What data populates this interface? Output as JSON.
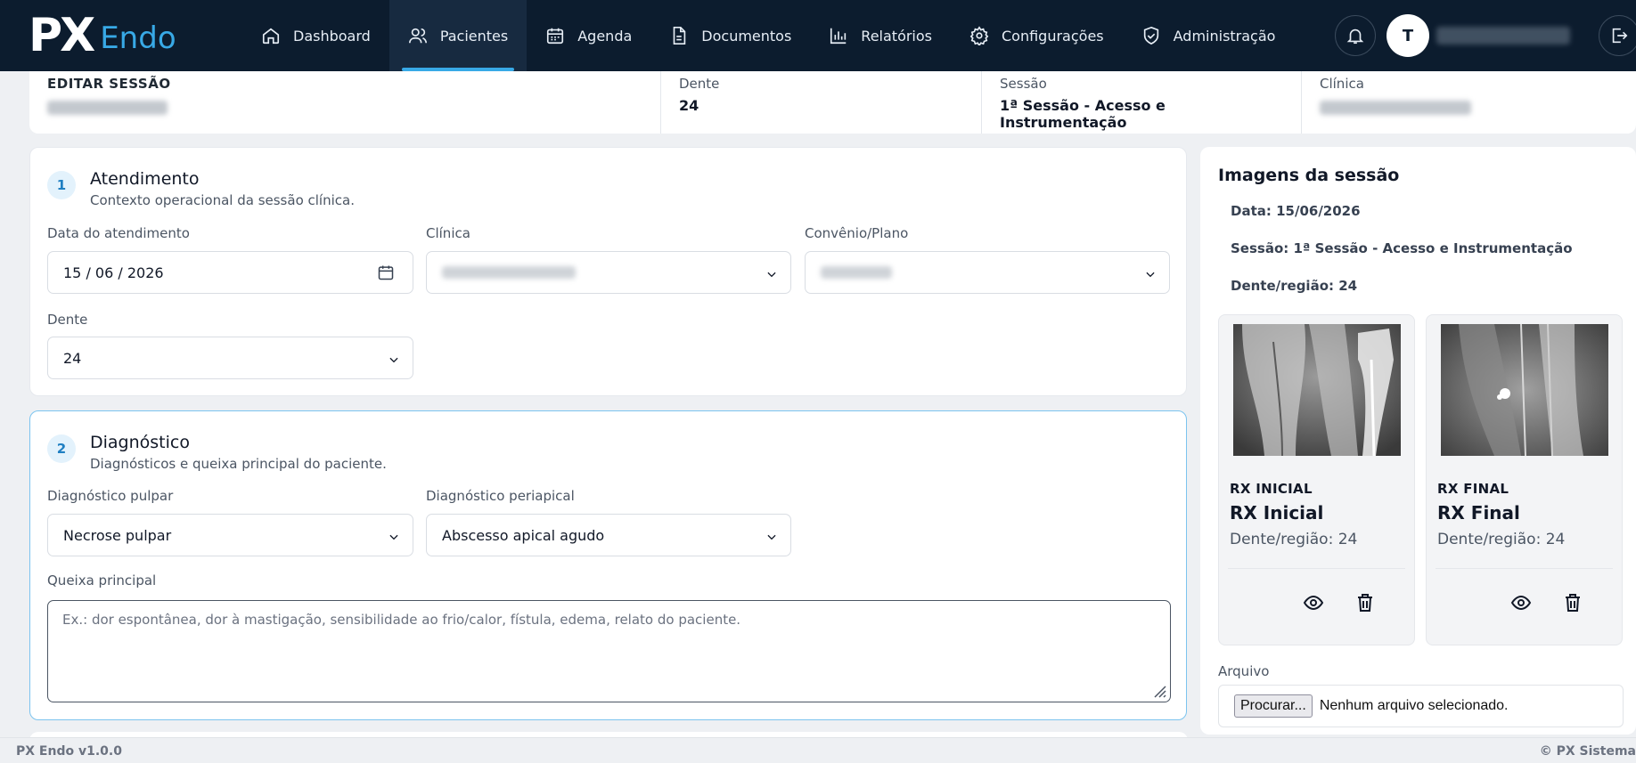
{
  "app": {
    "logo_px": "PX",
    "logo_endo": "Endo"
  },
  "nav": {
    "items": [
      {
        "label": "Dashboard",
        "icon": "home-icon"
      },
      {
        "label": "Pacientes",
        "icon": "users-icon",
        "active": true
      },
      {
        "label": "Agenda",
        "icon": "calendar-icon"
      },
      {
        "label": "Documentos",
        "icon": "document-icon"
      },
      {
        "label": "Relatórios",
        "icon": "bar-chart-icon"
      },
      {
        "label": "Configurações",
        "icon": "gear-icon"
      },
      {
        "label": "Administração",
        "icon": "shield-icon"
      }
    ],
    "avatar_initial": "T"
  },
  "summary": {
    "title": "EDITAR SESSÃO",
    "dente_label": "Dente",
    "dente_value": "24",
    "sessao_label": "Sessão",
    "sessao_value": "1ª Sessão - Acesso e Instrumentação",
    "clinica_label": "Clínica"
  },
  "atendimento": {
    "step": "1",
    "title": "Atendimento",
    "subtitle": "Contexto operacional da sessão clínica.",
    "date_label": "Data do atendimento",
    "date_value": "15 / 06 / 2026",
    "clinica_label": "Clínica",
    "convenio_label": "Convênio/Plano",
    "dente_label": "Dente",
    "dente_value": "24"
  },
  "diagnostico": {
    "step": "2",
    "title": "Diagnóstico",
    "subtitle": "Diagnósticos e queixa principal do paciente.",
    "pulpar_label": "Diagnóstico pulpar",
    "pulpar_value": "Necrose pulpar",
    "periapical_label": "Diagnóstico periapical",
    "periapical_value": "Abscesso apical agudo",
    "queixa_label": "Queixa principal",
    "queixa_placeholder": "Ex.: dor espontânea, dor à mastigação, sensibilidade ao frio/calor, fístula, edema, relato do paciente."
  },
  "images": {
    "title": "Imagens da sessão",
    "data_line": "Data: 15/06/2026",
    "sessao_line": "Sessão: 1ª Sessão - Acesso e Instrumentação",
    "dente_line": "Dente/região: 24",
    "items": [
      {
        "kicker": "RX INICIAL",
        "title": "RX Inicial",
        "sub": "Dente/região: 24"
      },
      {
        "kicker": "RX FINAL",
        "title": "RX Final",
        "sub": "Dente/região: 24"
      }
    ],
    "file_label": "Arquivo",
    "file_button": "Procurar...",
    "file_status": "Nenhum arquivo selecionado."
  },
  "footer": {
    "version": "PX Endo v1.0.0",
    "copyright": "© PX Sistema"
  }
}
